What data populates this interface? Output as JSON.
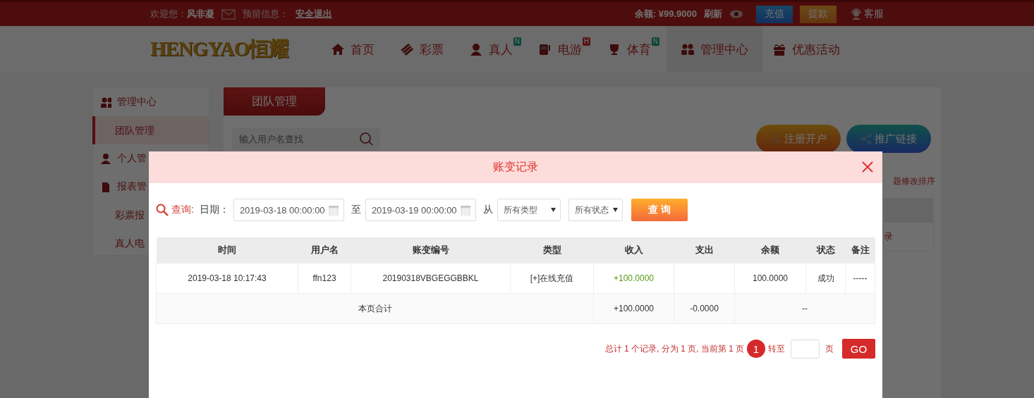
{
  "top_bar": {
    "welcome_label": "欢迎您：",
    "username": "风非凝",
    "message_label": "预留信息：",
    "logout": "安全退出",
    "balance": "余额: ¥99.9000",
    "refresh": "刷新",
    "deposit": "充值",
    "withdraw": "提款",
    "service": "客服"
  },
  "nav": {
    "logo": "HENGYAO恒耀",
    "items": [
      {
        "label": "首页",
        "selected": false
      },
      {
        "label": "彩票",
        "selected": false
      },
      {
        "label": "真人",
        "badge": "N",
        "selected": false
      },
      {
        "label": "电游",
        "badge": "H",
        "selected": false
      },
      {
        "label": "体育",
        "badge": "N",
        "selected": false
      },
      {
        "label": "管理中心",
        "selected": true
      },
      {
        "label": "优惠活动",
        "selected": false
      }
    ]
  },
  "sidebar": {
    "groups": [
      {
        "label": "管理中心",
        "children": [
          {
            "label": "团队管理",
            "selected": true
          }
        ]
      },
      {
        "label": "个人管"
      },
      {
        "label": "报表管",
        "children": [
          {
            "label": "彩票报",
            "selected": false
          },
          {
            "label": "真人电",
            "selected": false
          }
        ]
      }
    ]
  },
  "main": {
    "tab": {
      "label": "团队管理",
      "selected": true
    },
    "search": {
      "placeholder": "输入用户名查找"
    },
    "buttons": [
      "注册开户",
      "推广链接"
    ],
    "note": "题修改排序",
    "table_fragment": "录"
  },
  "modal": {
    "title": "账变记录",
    "query": {
      "label": "查询:",
      "date_label": "日期：",
      "start": "2019-03-18 00:00:00",
      "to": "至",
      "end": "2019-03-19 00:00:00",
      "from": "从",
      "type_select": "所有类型",
      "status_select": "所有状态",
      "button": "查 询"
    },
    "table": {
      "columns": [
        "时间",
        "用户名",
        "账变编号",
        "类型",
        "收入",
        "支出",
        "余额",
        "状态",
        "备注"
      ],
      "rows": [
        {
          "cells": [
            "2019-03-18 10:17:43",
            "ffn123",
            "20190318VBGEGGBBKL",
            "[+]在线充值",
            "+100.0000",
            "",
            "100.0000",
            "成功",
            "-----"
          ]
        }
      ],
      "total": {
        "label": "本页合计",
        "income": "+100.0000",
        "expense": "-0.0000",
        "balance": "--"
      }
    },
    "pagination": {
      "summary": "总计 1 个记录, 分为 1 页, 当前第 1 页",
      "current_page": "1",
      "goto_label": "转至",
      "page_unit": "页",
      "go": "GO"
    }
  }
}
